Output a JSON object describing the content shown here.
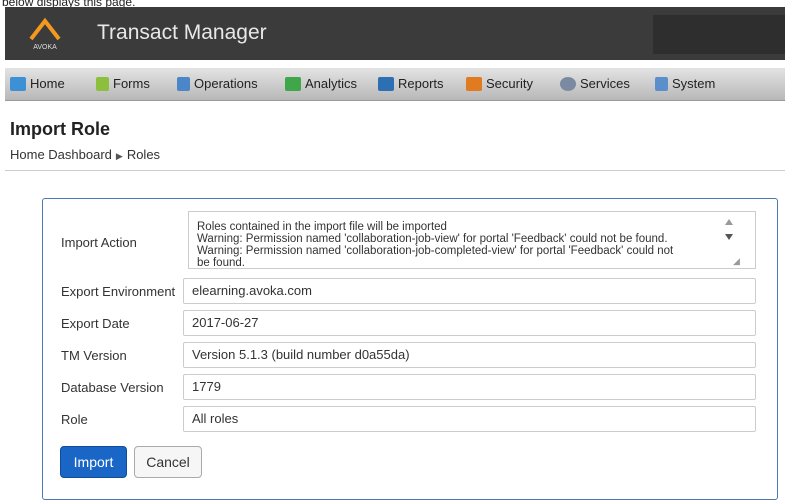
{
  "caption": "below displays this page.",
  "app": {
    "logo_text": "AVOKA",
    "title": "Transact Manager"
  },
  "nav": [
    {
      "label": "Home",
      "icon": "home-icon",
      "color": "#3d8fd6"
    },
    {
      "label": "Forms",
      "icon": "forms-icon",
      "color": "#8bbf3c"
    },
    {
      "label": "Operations",
      "icon": "operations-icon",
      "color": "#4a86c8"
    },
    {
      "label": "Analytics",
      "icon": "analytics-icon",
      "color": "#3fa64a"
    },
    {
      "label": "Reports",
      "icon": "reports-icon",
      "color": "#2d6fb3"
    },
    {
      "label": "Security",
      "icon": "security-icon",
      "color": "#e07b1f"
    },
    {
      "label": "Services",
      "icon": "services-icon",
      "color": "#7a8aa0"
    },
    {
      "label": "System",
      "icon": "system-icon",
      "color": "#5a8fcc"
    }
  ],
  "page": {
    "title": "Import Role",
    "breadcrumb": [
      "Home Dashboard",
      "Roles"
    ]
  },
  "form": {
    "import_action_label": "Import Action",
    "import_action_lines": [
      "Roles contained in the import file will be imported",
      "Warning: Permission named 'collaboration-job-view' for portal 'Feedback' could not be found.",
      "Warning: Permission named 'collaboration-job-completed-view' for portal 'Feedback' could not",
      "be found."
    ],
    "fields": [
      {
        "label": "Export Environment",
        "value": "elearning.avoka.com"
      },
      {
        "label": "Export Date",
        "value": "2017-06-27"
      },
      {
        "label": "TM Version",
        "value": "Version 5.1.3 (build number d0a55da)"
      },
      {
        "label": "Database Version",
        "value": "1779"
      },
      {
        "label": "Role",
        "value": "All roles"
      }
    ]
  },
  "buttons": {
    "import": "Import",
    "cancel": "Cancel"
  },
  "colors": {
    "primary": "#1a66c6",
    "topbar": "#3b3b3b",
    "logo": "#f39a1e",
    "panel_border": "#4a78b5"
  }
}
